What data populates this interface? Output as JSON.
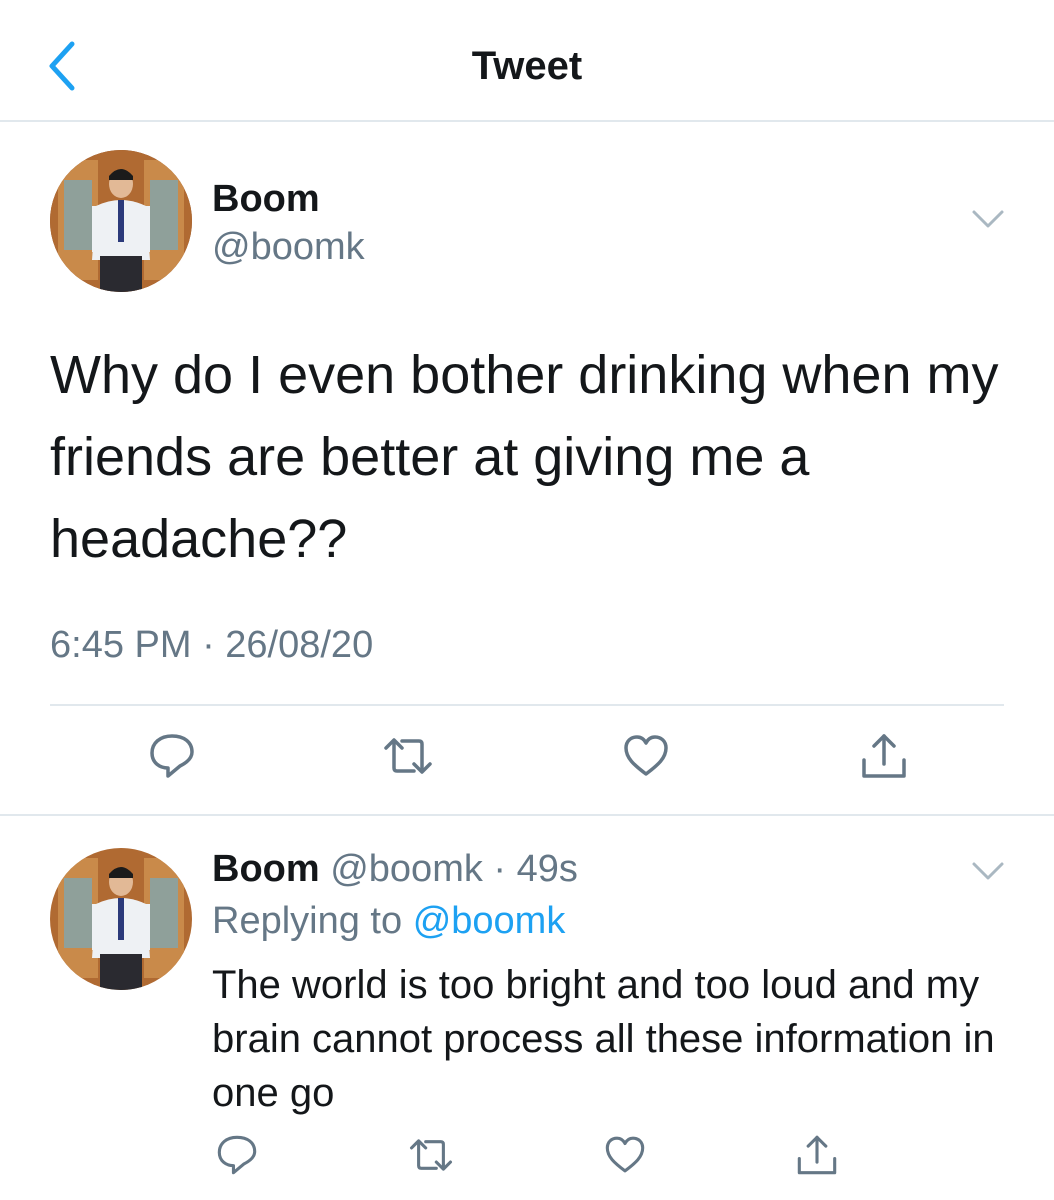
{
  "nav": {
    "title": "Tweet",
    "back_icon": "chevron-left-icon"
  },
  "tweet": {
    "author_name": "Boom",
    "author_handle": "@boomk",
    "text": "Why do I even bother drinking when my friends are better at giving me a headache??",
    "timestamp": "6:45 PM · 26/08/20",
    "actions": [
      "reply-icon",
      "retweet-icon",
      "like-icon",
      "share-icon"
    ]
  },
  "reply": {
    "author_name": "Boom",
    "meta": "@boomk · 49s",
    "replying_prefix": "Replying to",
    "replying_to": "@boomk",
    "text": "The world is too bright and too loud and my brain cannot process all these information in one go",
    "actions": [
      "reply-icon",
      "retweet-icon",
      "like-icon",
      "share-icon"
    ]
  },
  "colors": {
    "accent": "#1da1f2",
    "secondary_text": "#657786",
    "divider": "#e1e8ed",
    "icon": "#657786"
  }
}
